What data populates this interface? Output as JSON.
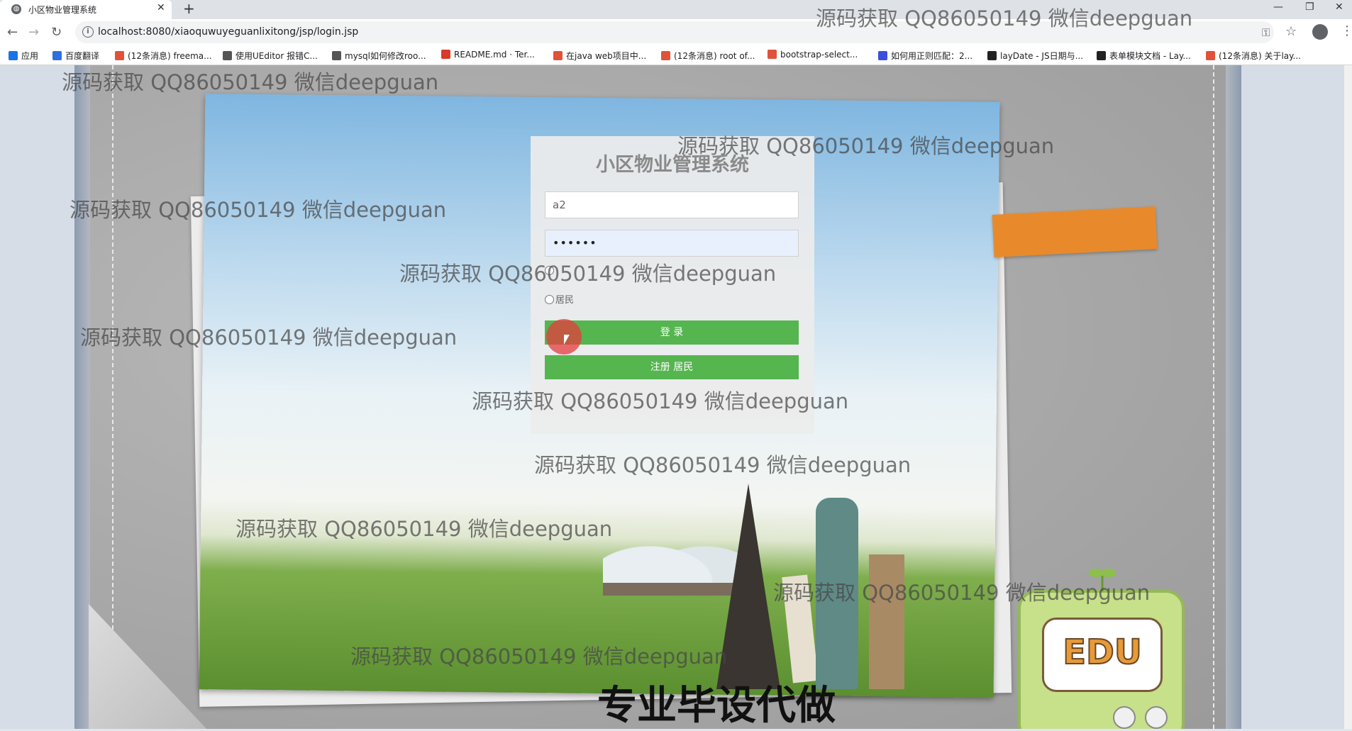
{
  "browser": {
    "tab_title": "小区物业管理系统",
    "tab_close": "✕",
    "new_tab": "+",
    "url": "localhost:8080/xiaoquwuyeguanlixitong/jsp/login.jsp",
    "bookmarks": [
      {
        "label": "应用",
        "color": "#1a73e8"
      },
      {
        "label": "百度翻译",
        "color": "#2f6fde"
      },
      {
        "label": "(12条消息) freema...",
        "color": "#e0523a"
      },
      {
        "label": "使用UEditor 报错C...",
        "color": "#555555"
      },
      {
        "label": "mysql如何修改roo...",
        "color": "#555555"
      },
      {
        "label": "README.md · Ter...",
        "color": "#d93a2a"
      },
      {
        "label": "在java web项目中...",
        "color": "#e0523a"
      },
      {
        "label": "(12条消息) root of...",
        "color": "#e0523a"
      },
      {
        "label": "bootstrap-select...",
        "color": "#e0523a"
      },
      {
        "label": "如何用正则匹配：2...",
        "color": "#3a4fd9"
      },
      {
        "label": "layDate - JS日期与...",
        "color": "#222222"
      },
      {
        "label": "表单模块文档 - Lay...",
        "color": "#222222"
      },
      {
        "label": "(12条消息) 关于lay...",
        "color": "#e0523a"
      }
    ]
  },
  "login": {
    "title": "小区物业管理系统",
    "username_value": "a2",
    "password_value": "••••••",
    "radio_resident_label": "居民",
    "login_button": "登 录",
    "register_button": "注册 居民"
  },
  "decor": {
    "edu_label": "EDU",
    "banner": "专业毕设代做"
  },
  "watermark_text": "源码获取 QQ86050149 微信deepguan"
}
